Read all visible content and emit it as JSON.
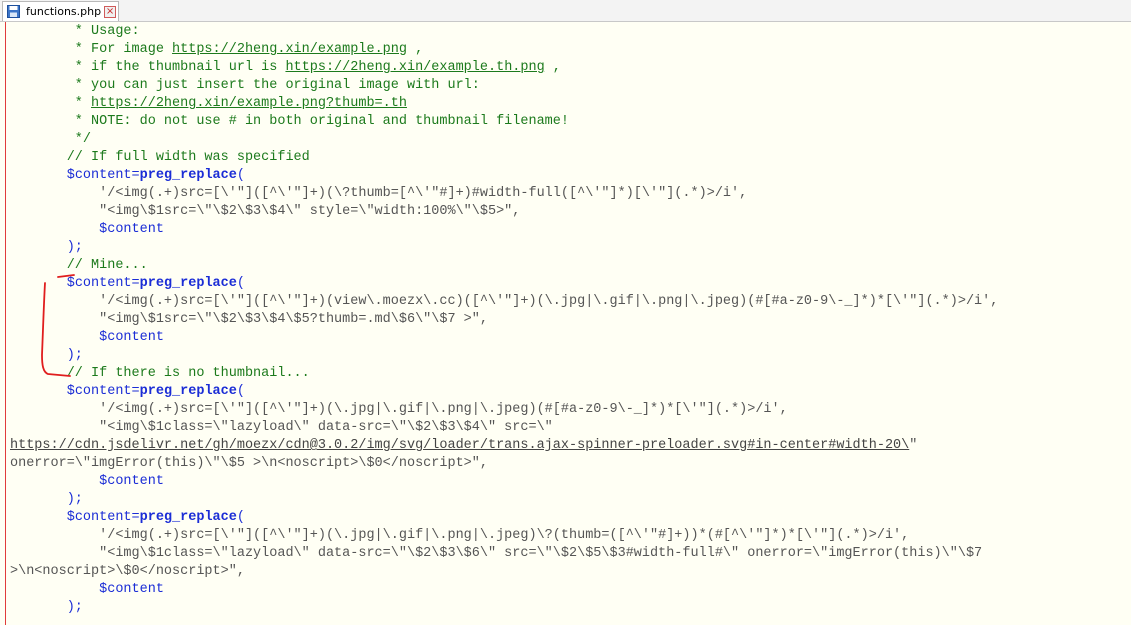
{
  "tab": {
    "filename": "functions.php",
    "close_glyph": "×"
  },
  "icons": {
    "file": "floppy-save-icon",
    "close": "close-icon"
  },
  "colors": {
    "comment": "#1c7a1c",
    "variable": "#1b2dd6",
    "string": "#555555",
    "annotation": "#e01e1e",
    "editor_bg": "#fffff4"
  },
  "code": {
    "l01": {
      "a": "        * Usage:"
    },
    "l02": {
      "a": "        * For image ",
      "url": "https://2heng.xin/example.png",
      "b": " ,"
    },
    "l03": {
      "a": "        * if the thumbnail url is ",
      "url": "https://2heng.xin/example.th.png",
      "b": " ,"
    },
    "l04": {
      "a": "        * you can just insert the original image with url:"
    },
    "l05": {
      "a": "        * ",
      "url": "https://2heng.xin/example.png?thumb=.th"
    },
    "l06": {
      "a": "        * NOTE: do not use # in both original and thumbnail filename!"
    },
    "l07": {
      "a": "        */"
    },
    "l08": {
      "a": "       // If full width was specified"
    },
    "l09": {
      "ind": "       ",
      "var": "$content",
      "eq": "=",
      "fn": "preg_replace",
      "p": "("
    },
    "l10": {
      "a": "           '/<img(.+)src=[\\'\"]([^\\'\"]+)(\\?thumb=[^\\'\"#]+)#width-full([^\\'\"]*)[\\'\"](.*)>/i',"
    },
    "l11": {
      "a": "           \"<img\\$1src=\\\"\\$2\\$3\\$4\\\" style=\\\"width:100%\\\"\\$5>\","
    },
    "l12": {
      "ind": "           ",
      "var": "$content"
    },
    "l13": {
      "a": "       );"
    },
    "l14": {
      "a": "       // Mine..."
    },
    "l15": {
      "ind": "       ",
      "var": "$content",
      "eq": "=",
      "fn": "preg_replace",
      "p": "("
    },
    "l16": {
      "a": "           '/<img(.+)src=[\\'\"]([^\\'\"]+)(view\\.moezx\\.cc)([^\\'\"]+)(\\.jpg|\\.gif|\\.png|\\.jpeg)(#[#a-z0-9\\-_]*)*[\\'\"](.*)>/i',"
    },
    "l17": {
      "a": "           \"<img\\$1src=\\\"\\$2\\$3\\$4\\$5?thumb=.md\\$6\\\"\\$7 >\","
    },
    "l18": {
      "ind": "           ",
      "var": "$content"
    },
    "l19": {
      "a": "       );"
    },
    "l20": {
      "a": "       // If there is no thumbnail..."
    },
    "l21": {
      "ind": "       ",
      "var": "$content",
      "eq": "=",
      "fn": "preg_replace",
      "p": "("
    },
    "l22": {
      "a": "           '/<img(.+)src=[\\'\"]([^\\'\"]+)(\\.jpg|\\.gif|\\.png|\\.jpeg)(#[#a-z0-9\\-_]*)*[\\'\"](.*)>/i',"
    },
    "l23": {
      "a": "           \"<img\\$1class=\\\"lazyload\\\" data-src=\\\"\\$2\\$3\\$4\\\" src=\\\""
    },
    "l24": {
      "url": "https://cdn.jsdelivr.net/gh/moezx/cdn@3.0.2/img/svg/loader/trans.ajax-spinner-preloader.svg#in-center#width-20\\",
      "b": "\""
    },
    "l25": {
      "a": "onerror=\\\"imgError(this)\\\"\\$5 >\\n<noscript>\\$0</noscript>\","
    },
    "l26": {
      "ind": "           ",
      "var": "$content"
    },
    "l27": {
      "a": "       );"
    },
    "l28": {
      "ind": "       ",
      "var": "$content",
      "eq": "=",
      "fn": "preg_replace",
      "p": "("
    },
    "l29": {
      "a": "           '/<img(.+)src=[\\'\"]([^\\'\"]+)(\\.jpg|\\.gif|\\.png|\\.jpeg)\\?(thumb=([^\\'\"#]+))*(#[^\\'\"]*)*[\\'\"](.*)>/i',"
    },
    "l30": {
      "a": "           \"<img\\$1class=\\\"lazyload\\\" data-src=\\\"\\$2\\$3\\$6\\\" src=\\\"\\$2\\$5\\$3#width-full#\\\" onerror=\\\"imgError(this)\\\"\\$7"
    },
    "l31": {
      "a": ">\\n<noscript>\\$0</noscript>\","
    },
    "l32": {
      "ind": "           ",
      "var": "$content"
    },
    "l33": {
      "a": "       );"
    }
  }
}
